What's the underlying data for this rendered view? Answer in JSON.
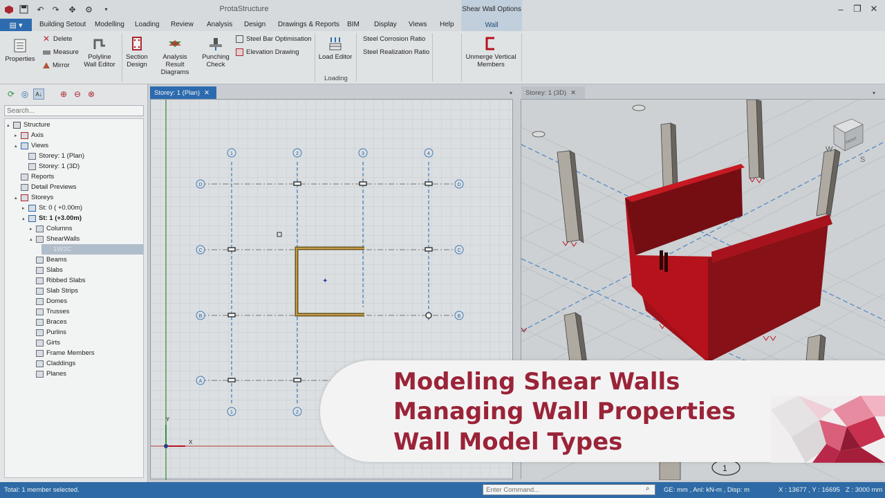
{
  "app": {
    "title": "ProtaStructure",
    "context_group": "Shear Wall Options"
  },
  "ribbon_tabs": [
    {
      "label": "Building Setout"
    },
    {
      "label": "Modelling"
    },
    {
      "label": "Loading"
    },
    {
      "label": "Review"
    },
    {
      "label": "Analysis"
    },
    {
      "label": "Design"
    },
    {
      "label": "Drawings & Reports"
    },
    {
      "label": "BIM"
    },
    {
      "label": "Display"
    },
    {
      "label": "Views"
    },
    {
      "label": "Help"
    }
  ],
  "context_tab": "Wall",
  "ribbon": {
    "properties": "Properties",
    "delete": "Delete",
    "measure": "Measure",
    "mirror": "Mirror",
    "polyline_wall_editor": [
      "Polyline",
      "Wall Editor"
    ],
    "section_design": [
      "Section",
      "Design"
    ],
    "analysis_result_diagrams": [
      "Analysis Result",
      "Diagrams"
    ],
    "punching_check": [
      "Punching",
      "Check"
    ],
    "steel_bar_optimisation": "Steel Bar Optimisation",
    "elevation_drawing": "Elevation Drawing",
    "load_editor": "Load Editor",
    "loading_group": "Loading",
    "steel_corrosion_ratio": "Steel Corrosion Ratio",
    "steel_realization_ratio": "Steel Realization Ratio",
    "unmerge_vertical_members": [
      "Unmerge Vertical",
      "Members"
    ]
  },
  "search": {
    "placeholder": "Search..."
  },
  "tree": [
    {
      "label": "Structure",
      "indent": 0,
      "arrow": "▴",
      "icon": "structure-icon",
      "bold": false
    },
    {
      "label": "Axis",
      "indent": 1,
      "arrow": "▸",
      "icon": "axis-icon",
      "bold": false
    },
    {
      "label": "Views",
      "indent": 1,
      "arrow": "▴",
      "icon": "views-icon",
      "bold": false
    },
    {
      "label": "Storey: 1 (Plan)",
      "indent": 2,
      "arrow": "",
      "icon": "plan-view-icon",
      "bold": false
    },
    {
      "label": "Storey: 1 (3D)",
      "indent": 2,
      "arrow": "",
      "icon": "3d-view-icon",
      "bold": false
    },
    {
      "label": "Reports",
      "indent": 1,
      "arrow": "",
      "icon": "reports-icon",
      "bold": false
    },
    {
      "label": "Detail Previews",
      "indent": 1,
      "arrow": "",
      "icon": "detail-previews-icon",
      "bold": false
    },
    {
      "label": "Storeys",
      "indent": 1,
      "arrow": "▴",
      "icon": "storeys-icon",
      "bold": false
    },
    {
      "label": "St: 0 ( +0.00m)",
      "indent": 2,
      "arrow": "▸",
      "icon": "storey-icon",
      "bold": false
    },
    {
      "label": "St: 1 (+3.00m)",
      "indent": 2,
      "arrow": "▴",
      "icon": "storey-icon",
      "bold": true
    },
    {
      "label": "Columns",
      "indent": 3,
      "arrow": "▸",
      "icon": "columns-icon",
      "bold": false
    },
    {
      "label": "ShearWalls",
      "indent": 3,
      "arrow": "▴",
      "icon": "shearwalls-icon",
      "bold": false
    },
    {
      "label": "1W2C",
      "indent": 4,
      "arrow": "",
      "icon": "",
      "bold": false,
      "selected": true
    },
    {
      "label": "Beams",
      "indent": 3,
      "arrow": "",
      "icon": "beams-icon",
      "bold": false
    },
    {
      "label": "Slabs",
      "indent": 3,
      "arrow": "",
      "icon": "slabs-icon",
      "bold": false
    },
    {
      "label": "Ribbed Slabs",
      "indent": 3,
      "arrow": "",
      "icon": "ribbed-slabs-icon",
      "bold": false
    },
    {
      "label": "Slab Strips",
      "indent": 3,
      "arrow": "",
      "icon": "slab-strips-icon",
      "bold": false
    },
    {
      "label": "Domes",
      "indent": 3,
      "arrow": "",
      "icon": "domes-icon",
      "bold": false
    },
    {
      "label": "Trusses",
      "indent": 3,
      "arrow": "",
      "icon": "trusses-icon",
      "bold": false
    },
    {
      "label": "Braces",
      "indent": 3,
      "arrow": "",
      "icon": "braces-icon",
      "bold": false
    },
    {
      "label": "Purlins",
      "indent": 3,
      "arrow": "",
      "icon": "purlins-icon",
      "bold": false
    },
    {
      "label": "Girts",
      "indent": 3,
      "arrow": "",
      "icon": "girts-icon",
      "bold": false
    },
    {
      "label": "Frame Members",
      "indent": 3,
      "arrow": "",
      "icon": "frame-members-icon",
      "bold": false
    },
    {
      "label": "Claddings",
      "indent": 3,
      "arrow": "",
      "icon": "claddings-icon",
      "bold": false
    },
    {
      "label": "Planes",
      "indent": 3,
      "arrow": "",
      "icon": "planes-icon",
      "bold": false
    }
  ],
  "doc_tabs": {
    "plan": "Storey: 1 (Plan)",
    "view3d": "Storey: 1 (3D)",
    "close": "✕"
  },
  "plan": {
    "col_axes": [
      "1",
      "2",
      "3",
      "4"
    ],
    "row_axes": [
      "D",
      "C",
      "B",
      "A"
    ],
    "axis_x": "X",
    "axis_y": "Y"
  },
  "view3d": {
    "cube_label": "FRONT",
    "compass": [
      "W",
      "S"
    ],
    "marker": "1"
  },
  "status": {
    "left": "Total: 1 member selected.",
    "command_placeholder": "Enter Command...",
    "units": "GE: mm , Anl: kN-m , Disp: m",
    "coords": "X : 13677 , Y : 16695",
    "z": "Z : 3000 mm"
  },
  "banner": {
    "lines": [
      "Modeling Shear Walls",
      "Managing Wall Properties",
      "Wall Model Types"
    ]
  },
  "colors": {
    "wall": "#c0101b",
    "accent": "#2e6fb7",
    "banner_text": "#9a2438"
  }
}
